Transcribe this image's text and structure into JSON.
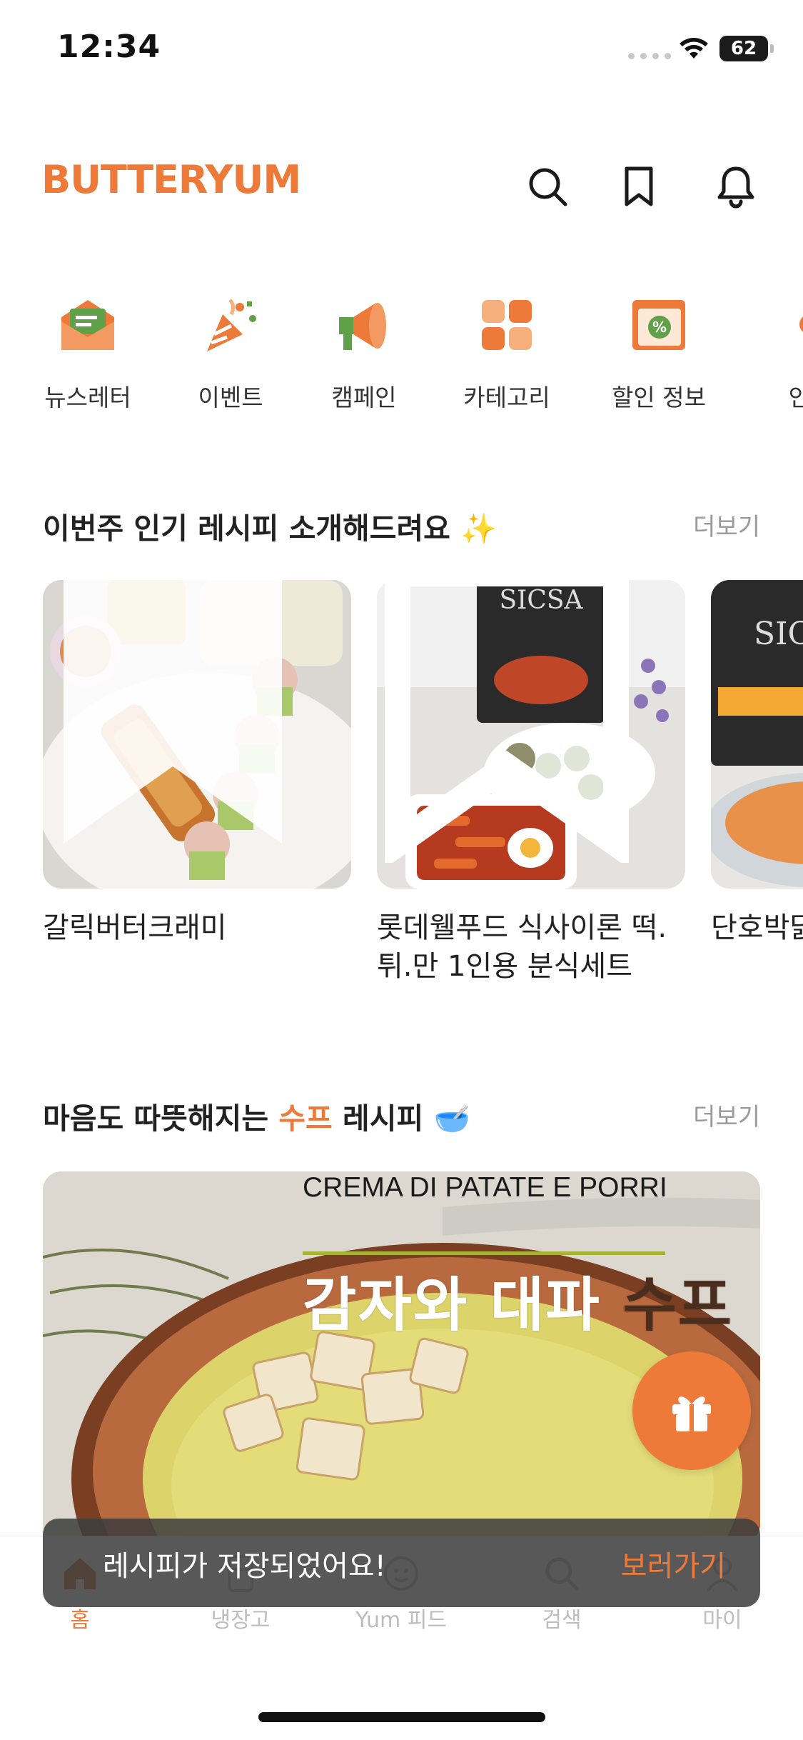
{
  "status_bar": {
    "time": "12:34",
    "battery": "62"
  },
  "header": {
    "logo": "BUTTERYUM"
  },
  "quick_menu": [
    {
      "label": "뉴스레터",
      "icon": "newsletter-icon"
    },
    {
      "label": "이벤트",
      "icon": "party-popper-icon"
    },
    {
      "label": "캠페인",
      "icon": "megaphone-icon"
    },
    {
      "label": "카테고리",
      "icon": "category-grid-icon"
    },
    {
      "label": "할인 정보",
      "icon": "discount-calendar-icon"
    },
    {
      "label": "인기",
      "icon": "popular-icon"
    }
  ],
  "popular_section": {
    "title": "이번주 인기 레시피 소개해드려요",
    "emoji": "✨",
    "more": "더보기",
    "cards": [
      {
        "title": "갈릭버터크래미"
      },
      {
        "title": "롯데웰푸드 식사이론 떡.튀.만 1인용 분식세트"
      },
      {
        "title": "단호박닭가슴살 야채비빔"
      }
    ]
  },
  "soup_section": {
    "title_before": "마음도 따뜻해지는 ",
    "title_accent": "수프",
    "title_after": " 레시피",
    "emoji": "🥣",
    "more": "더보기",
    "banner": {
      "subtitle": "CREMA DI PATATE E PORRI",
      "title_light": "감자와 대파 ",
      "title_dark": "수프"
    }
  },
  "toast": {
    "message": "레시피가 저장되었어요!",
    "action": "보러가기"
  },
  "tabs": [
    {
      "label": "홈",
      "icon": "home-icon",
      "active": true
    },
    {
      "label": "냉장고",
      "icon": "fridge-icon",
      "active": false
    },
    {
      "label": "Yum 피드",
      "icon": "feed-icon",
      "active": false
    },
    {
      "label": "검색",
      "icon": "search-icon",
      "active": false
    },
    {
      "label": "마이",
      "icon": "profile-icon",
      "active": false
    }
  ],
  "colors": {
    "brand": "#ee7a3a",
    "accent_green": "#5fa048",
    "text": "#222222",
    "muted": "#9a9a9a"
  }
}
